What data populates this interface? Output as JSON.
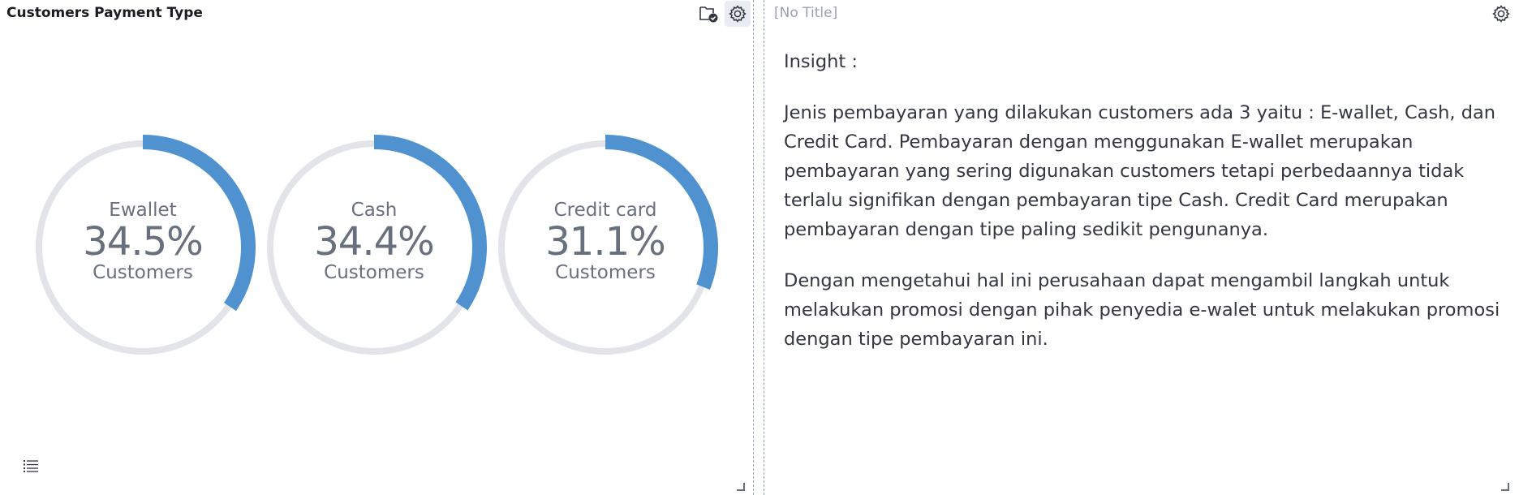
{
  "left_panel": {
    "title": "Customers Payment Type",
    "icons": {
      "folder": "folder-check-icon",
      "settings": "gear-icon",
      "legend": "list-icon"
    }
  },
  "right_panel": {
    "title": "[No Title]",
    "icons": {
      "settings": "gear-icon"
    },
    "heading": "Insight :",
    "paragraph1": "Jenis pembayaran yang dilakukan customers ada 3 yaitu : E-wallet, Cash, dan Credit Card. Pembayaran dengan menggunakan E-wallet merupakan pembayaran yang sering digunakan customers tetapi perbedaannya tidak terlalu signifikan dengan pembayaran tipe Cash. Credit Card merupakan pembayaran dengan tipe paling sedikit pengunanya.",
    "paragraph2": "Dengan mengetahui hal ini perusahaan dapat mengambil langkah untuk melakukan promosi dengan pihak penyedia e-walet untuk melakukan promosi dengan tipe pembayaran ini."
  },
  "colors": {
    "arc": "#4f92cf",
    "track": "#e2e4e9",
    "text": "#69707d"
  },
  "chart_data": {
    "type": "gauge",
    "series": [
      {
        "label": "Ewallet",
        "value": 34.5,
        "display": "34.5%",
        "sublabel": "Customers"
      },
      {
        "label": "Cash",
        "value": 34.4,
        "display": "34.4%",
        "sublabel": "Customers"
      },
      {
        "label": "Credit card",
        "value": 31.1,
        "display": "31.1%",
        "sublabel": "Customers"
      }
    ],
    "range": [
      0,
      100
    ]
  }
}
